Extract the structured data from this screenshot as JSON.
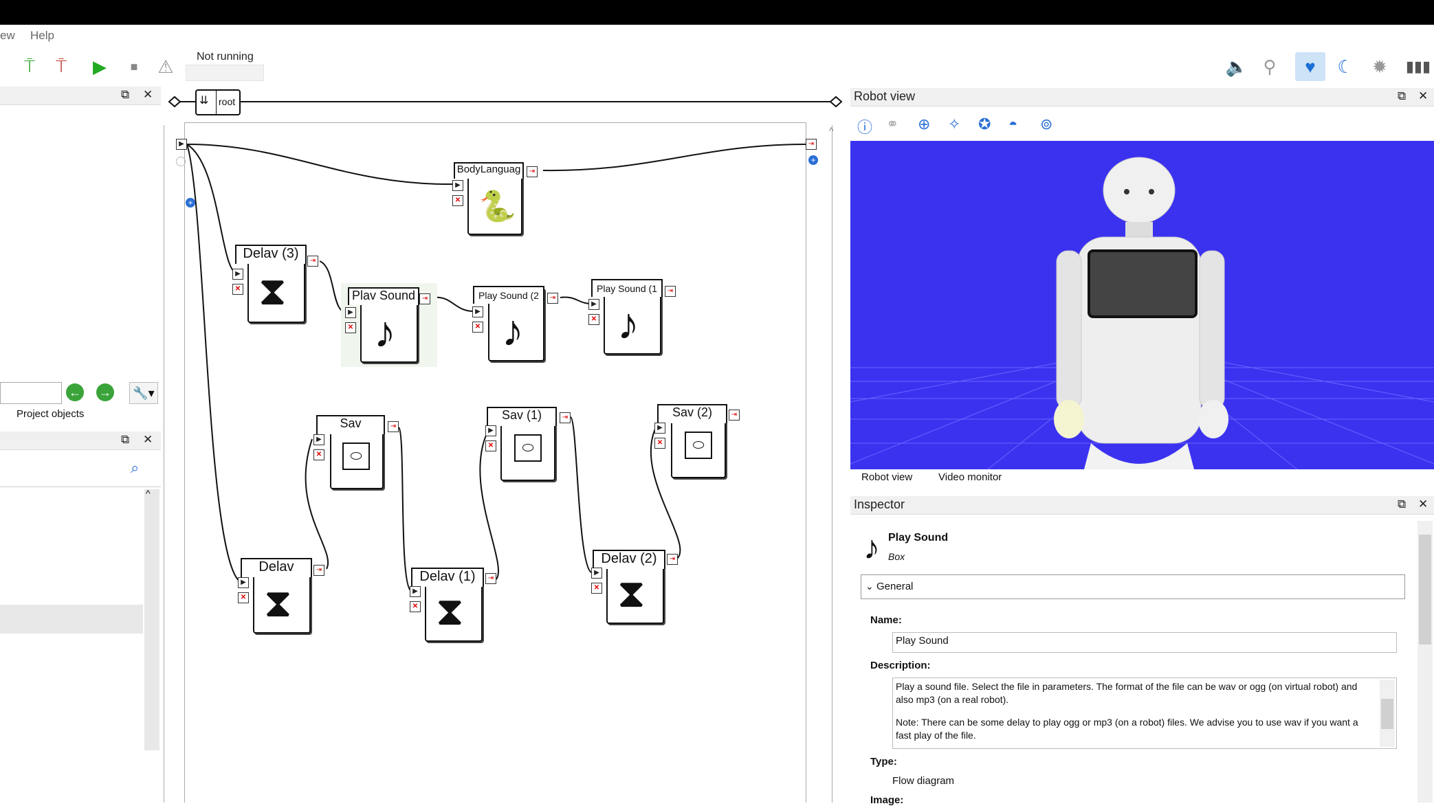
{
  "menubar": {
    "items": [
      "ew",
      "Help"
    ]
  },
  "toolbar": {
    "status_text": "Not running",
    "icons": [
      "connect-icon",
      "disconnect-icon",
      "play-icon",
      "stop-icon",
      "warning-icon",
      "volume-icon",
      "posture-icon",
      "heart-icon",
      "moon-icon",
      "gear-icon",
      "battery-icon"
    ]
  },
  "left_panel": {
    "tab_project_objects": "Project objects"
  },
  "breadcrumb": {
    "root": "root"
  },
  "diagram": {
    "boxes": [
      {
        "id": "body-language",
        "label": "BodyLanguag",
        "icon": "python-icon"
      },
      {
        "id": "delay3",
        "label": "Delav (3)",
        "icon": "hourglass-icon"
      },
      {
        "id": "playsound",
        "label": "Plav Sound",
        "icon": "music-note-icon"
      },
      {
        "id": "playsound2",
        "label": "Play Sound (2",
        "icon": "music-note-icon"
      },
      {
        "id": "playsound1",
        "label": "Play Sound (1",
        "icon": "music-note-icon"
      },
      {
        "id": "say",
        "label": "Sav",
        "icon": "speech-bubble-icon"
      },
      {
        "id": "say1",
        "label": "Sav (1)",
        "icon": "speech-bubble-icon"
      },
      {
        "id": "say2",
        "label": "Sav (2)",
        "icon": "speech-bubble-icon"
      },
      {
        "id": "delay",
        "label": "Delav",
        "icon": "hourglass-icon"
      },
      {
        "id": "delay1",
        "label": "Delav (1)",
        "icon": "hourglass-icon"
      },
      {
        "id": "delay2",
        "label": "Delav (2)",
        "icon": "hourglass-icon"
      }
    ]
  },
  "robot_panel": {
    "title": "Robot view",
    "tabs": [
      "Robot view",
      "Video monitor"
    ],
    "colors": {
      "background": "#3b32f0",
      "grid": "#6a64ff"
    }
  },
  "inspector": {
    "title": "Inspector",
    "item_name": "Play Sound",
    "item_kind": "Box",
    "section": "General",
    "name_label": "Name:",
    "name_value": "Play Sound",
    "description_label": "Description:",
    "description_p1": "Play a sound file. Select the file in parameters. The format of the file can be wav or ogg (on virtual robot) and also mp3 (on a real robot).",
    "description_p2": "Note: There can be some delay to play ogg or mp3 (on a robot) files. We advise you to use wav if you want a fast play of the file.",
    "type_label": "Type:",
    "type_value": "Flow diagram",
    "image_label": "Image:"
  }
}
